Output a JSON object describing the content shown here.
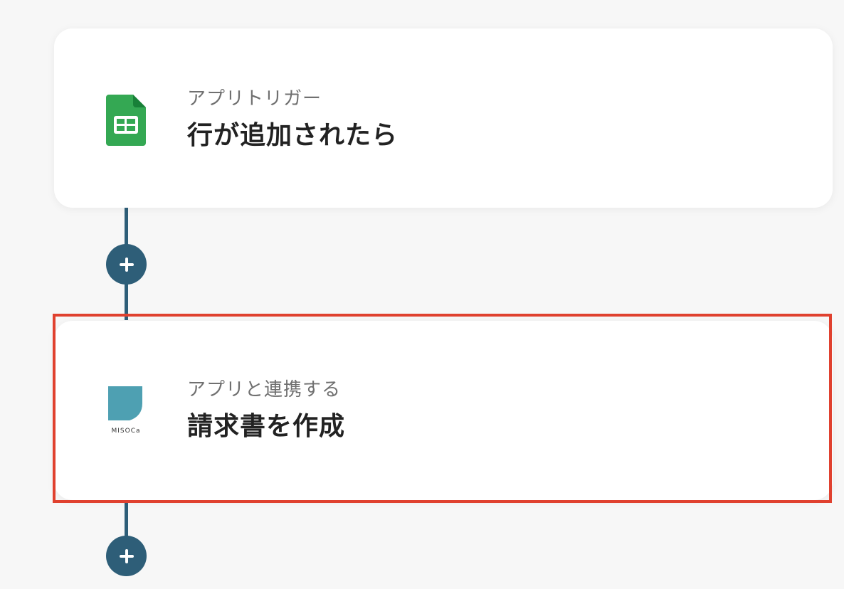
{
  "flow": {
    "steps": [
      {
        "app": "Google Sheets",
        "icon": "google-sheets-icon",
        "subtitle": "アプリトリガー",
        "title": "行が追加されたら"
      },
      {
        "app": "Misoca",
        "icon": "misoca-icon",
        "logo_text": "MISOCa",
        "subtitle": "アプリと連携する",
        "title": "請求書を作成"
      }
    ],
    "add_step_icon": "plus-icon"
  },
  "colors": {
    "connector": "#2e5e78",
    "highlight": "#e0412f",
    "sheets_green": "#34a853",
    "misoca_teal": "#4ea0b2",
    "background": "#f7f7f7"
  }
}
